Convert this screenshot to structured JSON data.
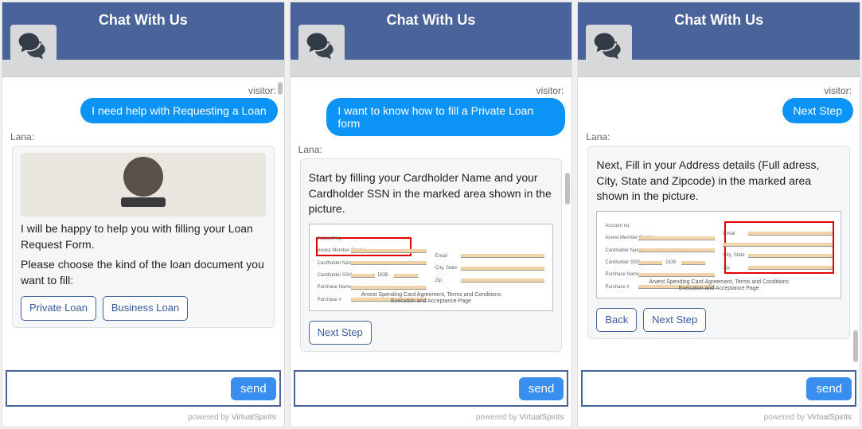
{
  "header_title": "Chat With Us",
  "visitor_label": "visitor:",
  "bot_label": "Lana:",
  "send_label": "send",
  "footer_prefix": "powered by ",
  "footer_link": "VirtualSpirits",
  "panel1": {
    "user_msg": "I need help with Requesting a Loan",
    "bot_line1": "I will be happy to help you with filling your Loan Request Form.",
    "bot_line2": "Please choose the kind of the loan document you want to fill:",
    "options": [
      "Private Loan",
      "Business Loan"
    ]
  },
  "panel2": {
    "user_msg": "I want to know how to fill a Private Loan form",
    "bot_text": "Start by filling your Cardholder Name and your Cardholder SSN in the marked area shown in the picture.",
    "form_caption1": "Arvest Spending Card Agreement, Terms and Conditions",
    "form_caption2": "Execution and Acceptance Page",
    "next_label": "Next Step"
  },
  "panel3": {
    "user_msg": "Next Step",
    "bot_text": "Next, Fill in your Address details (Full adress, City, State and Zipcode) in the marked area shown in the picture.",
    "form_caption1": "Arvest Spending Card Agreement, Terms and Conditions",
    "form_caption2": "Execution and Acceptance Page",
    "back_label": "Back",
    "next_label": "Next Step"
  },
  "form_labels": {
    "l1": "Account no.",
    "l2": "Arvest Member Card #",
    "l3": "Cardholder Name",
    "l4": "Cardholder SSN",
    "l5": "DOB",
    "l6": "Purchase Name",
    "l7": "Purchase #",
    "r1": "Email",
    "r2": "City, State",
    "r3": "Zip"
  }
}
